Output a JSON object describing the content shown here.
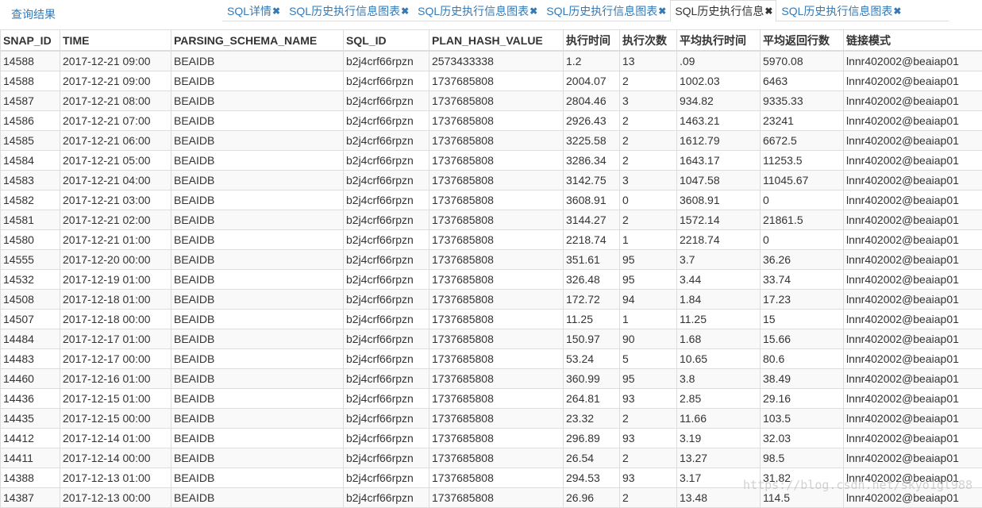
{
  "header": {
    "home_link": "查询结果",
    "tabs": [
      {
        "label": "SQL详情",
        "active": false
      },
      {
        "label": "SQL历史执行信息图表",
        "active": false
      },
      {
        "label": "SQL历史执行信息图表",
        "active": false
      },
      {
        "label": "SQL历史执行信息图表",
        "active": false
      },
      {
        "label": "SQL历史执行信息",
        "active": true
      },
      {
        "label": "SQL历史执行信息图表",
        "active": false
      }
    ],
    "close_glyph": "✖"
  },
  "table": {
    "columns": [
      "SNAP_ID",
      "TIME",
      "PARSING_SCHEMA_NAME",
      "SQL_ID",
      "PLAN_HASH_VALUE",
      "执行时间",
      "执行次数",
      "平均执行时间",
      "平均返回行数",
      "链接模式"
    ],
    "rows": [
      [
        "14588",
        "2017-12-21 09:00",
        "BEAIDB",
        "b2j4crf66rpzn",
        "2573433338",
        "1.2",
        "13",
        ".09",
        "5970.08",
        "lnnr402002@beaiap01"
      ],
      [
        "14588",
        "2017-12-21 09:00",
        "BEAIDB",
        "b2j4crf66rpzn",
        "1737685808",
        "2004.07",
        "2",
        "1002.03",
        "6463",
        "lnnr402002@beaiap01"
      ],
      [
        "14587",
        "2017-12-21 08:00",
        "BEAIDB",
        "b2j4crf66rpzn",
        "1737685808",
        "2804.46",
        "3",
        "934.82",
        "9335.33",
        "lnnr402002@beaiap01"
      ],
      [
        "14586",
        "2017-12-21 07:00",
        "BEAIDB",
        "b2j4crf66rpzn",
        "1737685808",
        "2926.43",
        "2",
        "1463.21",
        "23241",
        "lnnr402002@beaiap01"
      ],
      [
        "14585",
        "2017-12-21 06:00",
        "BEAIDB",
        "b2j4crf66rpzn",
        "1737685808",
        "3225.58",
        "2",
        "1612.79",
        "6672.5",
        "lnnr402002@beaiap01"
      ],
      [
        "14584",
        "2017-12-21 05:00",
        "BEAIDB",
        "b2j4crf66rpzn",
        "1737685808",
        "3286.34",
        "2",
        "1643.17",
        "11253.5",
        "lnnr402002@beaiap01"
      ],
      [
        "14583",
        "2017-12-21 04:00",
        "BEAIDB",
        "b2j4crf66rpzn",
        "1737685808",
        "3142.75",
        "3",
        "1047.58",
        "11045.67",
        "lnnr402002@beaiap01"
      ],
      [
        "14582",
        "2017-12-21 03:00",
        "BEAIDB",
        "b2j4crf66rpzn",
        "1737685808",
        "3608.91",
        "0",
        "3608.91",
        "0",
        "lnnr402002@beaiap01"
      ],
      [
        "14581",
        "2017-12-21 02:00",
        "BEAIDB",
        "b2j4crf66rpzn",
        "1737685808",
        "3144.27",
        "2",
        "1572.14",
        "21861.5",
        "lnnr402002@beaiap01"
      ],
      [
        "14580",
        "2017-12-21 01:00",
        "BEAIDB",
        "b2j4crf66rpzn",
        "1737685808",
        "2218.74",
        "1",
        "2218.74",
        "0",
        "lnnr402002@beaiap01"
      ],
      [
        "14555",
        "2017-12-20 00:00",
        "BEAIDB",
        "b2j4crf66rpzn",
        "1737685808",
        "351.61",
        "95",
        "3.7",
        "36.26",
        "lnnr402002@beaiap01"
      ],
      [
        "14532",
        "2017-12-19 01:00",
        "BEAIDB",
        "b2j4crf66rpzn",
        "1737685808",
        "326.48",
        "95",
        "3.44",
        "33.74",
        "lnnr402002@beaiap01"
      ],
      [
        "14508",
        "2017-12-18 01:00",
        "BEAIDB",
        "b2j4crf66rpzn",
        "1737685808",
        "172.72",
        "94",
        "1.84",
        "17.23",
        "lnnr402002@beaiap01"
      ],
      [
        "14507",
        "2017-12-18 00:00",
        "BEAIDB",
        "b2j4crf66rpzn",
        "1737685808",
        "11.25",
        "1",
        "11.25",
        "15",
        "lnnr402002@beaiap01"
      ],
      [
        "14484",
        "2017-12-17 01:00",
        "BEAIDB",
        "b2j4crf66rpzn",
        "1737685808",
        "150.97",
        "90",
        "1.68",
        "15.66",
        "lnnr402002@beaiap01"
      ],
      [
        "14483",
        "2017-12-17 00:00",
        "BEAIDB",
        "b2j4crf66rpzn",
        "1737685808",
        "53.24",
        "5",
        "10.65",
        "80.6",
        "lnnr402002@beaiap01"
      ],
      [
        "14460",
        "2017-12-16 01:00",
        "BEAIDB",
        "b2j4crf66rpzn",
        "1737685808",
        "360.99",
        "95",
        "3.8",
        "38.49",
        "lnnr402002@beaiap01"
      ],
      [
        "14436",
        "2017-12-15 01:00",
        "BEAIDB",
        "b2j4crf66rpzn",
        "1737685808",
        "264.81",
        "93",
        "2.85",
        "29.16",
        "lnnr402002@beaiap01"
      ],
      [
        "14435",
        "2017-12-15 00:00",
        "BEAIDB",
        "b2j4crf66rpzn",
        "1737685808",
        "23.32",
        "2",
        "11.66",
        "103.5",
        "lnnr402002@beaiap01"
      ],
      [
        "14412",
        "2017-12-14 01:00",
        "BEAIDB",
        "b2j4crf66rpzn",
        "1737685808",
        "296.89",
        "93",
        "3.19",
        "32.03",
        "lnnr402002@beaiap01"
      ],
      [
        "14411",
        "2017-12-14 00:00",
        "BEAIDB",
        "b2j4crf66rpzn",
        "1737685808",
        "26.54",
        "2",
        "13.27",
        "98.5",
        "lnnr402002@beaiap01"
      ],
      [
        "14388",
        "2017-12-13 01:00",
        "BEAIDB",
        "b2j4crf66rpzn",
        "1737685808",
        "294.53",
        "93",
        "3.17",
        "31.82",
        "lnnr402002@beaiap01"
      ],
      [
        "14387",
        "2017-12-13 00:00",
        "BEAIDB",
        "b2j4crf66rpzn",
        "1737685808",
        "26.96",
        "2",
        "13.48",
        "114.5",
        "lnnr402002@beaiap01"
      ]
    ]
  },
  "watermark": "https://blog.csdn.net/skyo1gl988",
  "colors": {
    "link": "#337ab7",
    "border": "#dddddd",
    "stripe": "#f9f9f9",
    "text": "#333333"
  }
}
